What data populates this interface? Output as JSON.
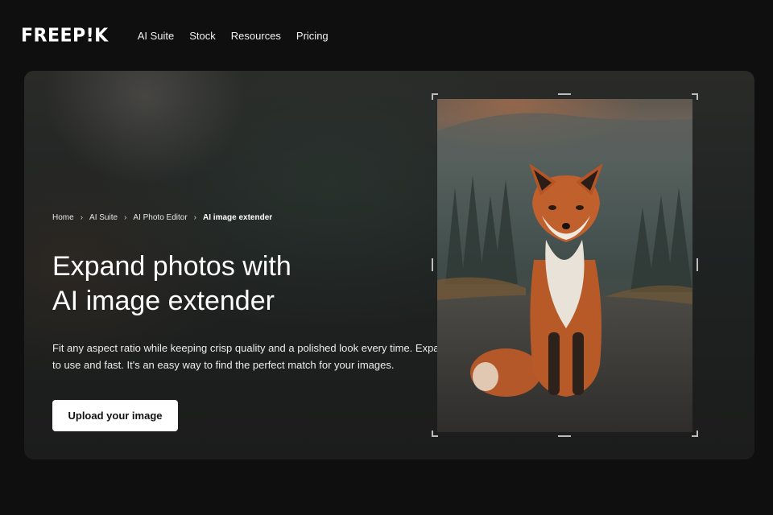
{
  "logo": "FREEP!K",
  "nav": [
    "AI Suite",
    "Stock",
    "Resources",
    "Pricing"
  ],
  "breadcrumb": {
    "items": [
      "Home",
      "AI Suite",
      "AI Photo Editor"
    ],
    "current": "AI image extender"
  },
  "hero": {
    "title_line1": "Expand photos with",
    "title_line2": "AI image extender",
    "description": "Fit any aspect ratio while keeping crisp quality and a polished look every time. Expand is free to use and fast. It's an easy way to find the perfect match for your images.",
    "upload_label": "Upload your image"
  },
  "colors": {
    "background": "#0f0f0f",
    "button_bg": "#ffffff",
    "fox": "#b8592a"
  }
}
